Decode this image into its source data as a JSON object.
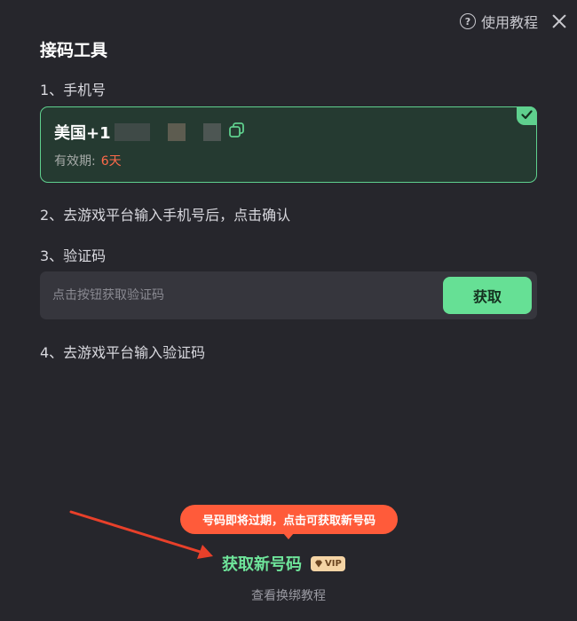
{
  "header": {
    "help_label": "使用教程",
    "help_icon": "question-circle-icon",
    "close_icon": "close-icon"
  },
  "title": "接码工具",
  "steps": {
    "step1": "1、手机号",
    "step2": "2、去游戏平台输入手机号后，点击确认",
    "step3": "3、验证码",
    "step4": "4、去游戏平台输入验证码"
  },
  "phone": {
    "prefix": "美国+1",
    "validity_label": "有效期:",
    "validity_value": "6天",
    "selected": true
  },
  "code": {
    "placeholder": "点击按钮获取验证码",
    "button_label": "获取"
  },
  "tooltip": "号码即将过期，点击可获取新号码",
  "new_number": {
    "label": "获取新号码",
    "vip": "VIP"
  },
  "tutorial_link": "查看换绑教程",
  "colors": {
    "background": "#26262c",
    "accent_green": "#66e095",
    "warning_red": "#ff5b3a",
    "vip_gold": "#f5d4a5"
  }
}
